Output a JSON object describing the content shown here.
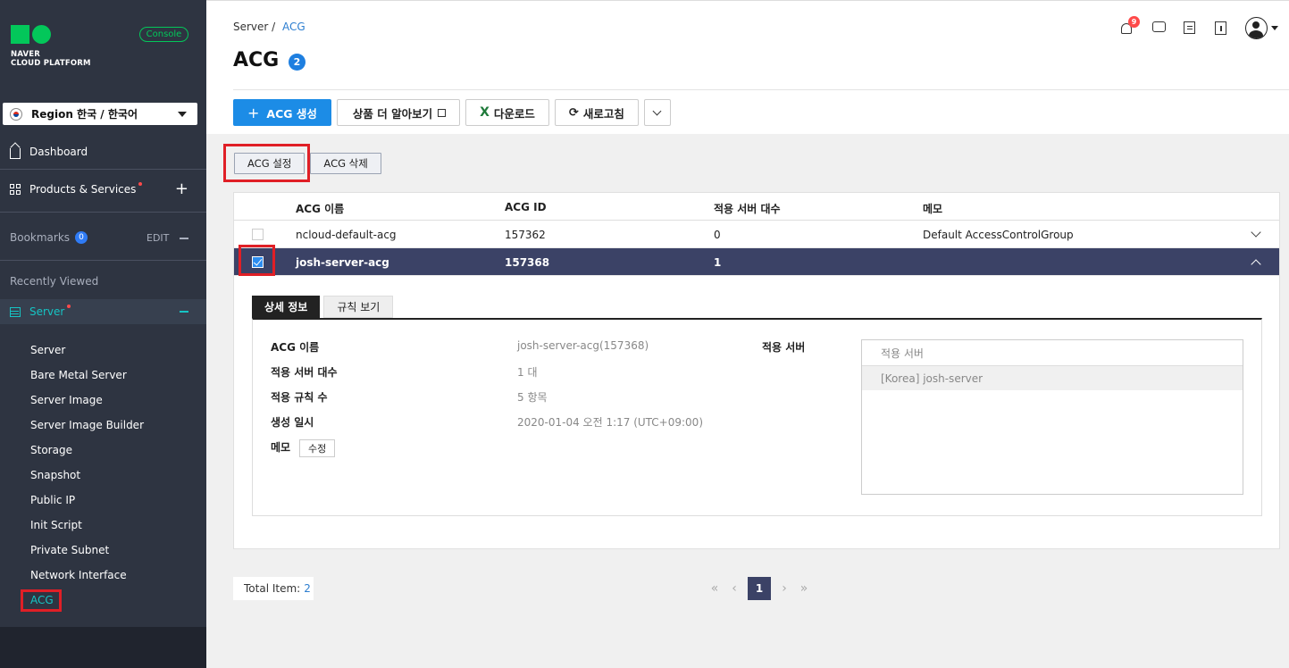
{
  "sidebar": {
    "brand_line1": "NAVER",
    "brand_line2": "CLOUD PLATFORM",
    "console_badge": "Console",
    "region_label": "Region 한국 / 한국어",
    "dashboard": "Dashboard",
    "products": "Products & Services",
    "bookmarks": "Bookmarks",
    "bookmarks_count": "0",
    "bookmarks_edit": "EDIT",
    "recently_viewed": "Recently Viewed",
    "server_group": "Server",
    "items": [
      {
        "label": "Server"
      },
      {
        "label": "Bare Metal Server"
      },
      {
        "label": "Server Image"
      },
      {
        "label": "Server Image Builder"
      },
      {
        "label": "Storage"
      },
      {
        "label": "Snapshot"
      },
      {
        "label": "Public IP"
      },
      {
        "label": "Init Script"
      },
      {
        "label": "Private Subnet"
      },
      {
        "label": "Network Interface"
      },
      {
        "label": "ACG"
      }
    ]
  },
  "header": {
    "breadcrumb_parent": "Server /",
    "breadcrumb_current": "ACG",
    "title": "ACG",
    "title_count": "2",
    "notification_count": "9"
  },
  "toolbar": {
    "create": "ACG 생성",
    "learn_more": "상품 더 알아보기",
    "download": "다운로드",
    "refresh": "새로고침"
  },
  "sub_toolbar": {
    "settings": "ACG 설정",
    "delete": "ACG 삭제"
  },
  "table": {
    "columns": [
      "ACG 이름",
      "ACG ID",
      "적용 서버 대수",
      "메모"
    ],
    "rows": [
      {
        "name": "ncloud-default-acg",
        "id": "157362",
        "servers": "0",
        "memo": "Default AccessControlGroup",
        "selected": false
      },
      {
        "name": "josh-server-acg",
        "id": "157368",
        "servers": "1",
        "memo": "",
        "selected": true
      }
    ]
  },
  "detail": {
    "tab_info": "상세 정보",
    "tab_rules": "규칙 보기",
    "labels": {
      "name": "ACG 이름",
      "server_count": "적용 서버 대수",
      "rule_count": "적용 규칙 수",
      "created": "생성 일시",
      "memo": "메모",
      "servers": "적용 서버"
    },
    "values": {
      "name": "josh-server-acg(157368)",
      "server_count": "1 대",
      "rule_count": "5 항목",
      "created": "2020-01-04 오전 1:17 (UTC+09:00)"
    },
    "memo_edit": "수정",
    "server_list_header": "적용 서버",
    "server_list": [
      "[Korea] josh-server"
    ]
  },
  "footer": {
    "total_label": "Total Item:",
    "total_value": "2",
    "current_page": "1"
  },
  "colors": {
    "accent": "#1c8ce6",
    "selected_row": "#3b4266",
    "sidebar_bg": "#2e3441",
    "sidebar_active": "#16c4c4",
    "highlight": "#e01f26"
  }
}
